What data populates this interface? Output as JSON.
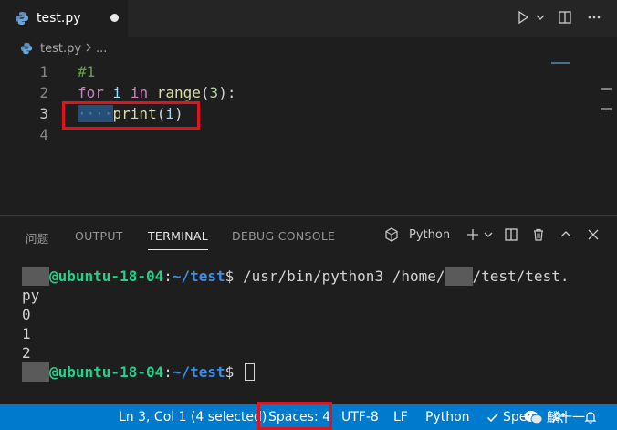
{
  "tab": {
    "filename": "test.py"
  },
  "breadcrumb": {
    "filename": "test.py",
    "more": "..."
  },
  "editor": {
    "line_numbers": [
      "1",
      "2",
      "3",
      "4"
    ],
    "line1": {
      "comment": "#1"
    },
    "line2": {
      "kw_for": "for",
      "var": "i",
      "kw_in": "in",
      "fn": "range",
      "open": "(",
      "num": "3",
      "close": "):"
    },
    "line3": {
      "whitespace_dots": "····",
      "fn": "print",
      "open": "(",
      "var": "i",
      "close": ")"
    }
  },
  "panel": {
    "tabs": [
      "问题",
      "OUTPUT",
      "TERMINAL",
      "DEBUG CONSOLE"
    ],
    "active_tab": "TERMINAL",
    "shell_label": "Python"
  },
  "terminal": {
    "prompt_user": "@ubuntu-18-04",
    "prompt_sep": ":",
    "prompt_path": "~/test",
    "prompt_symbol": "$",
    "command_part1": " /usr/bin/python3 /home/",
    "command_part2": "/test/test.",
    "command_wrap": "py",
    "outputs": [
      "0",
      "1",
      "2"
    ]
  },
  "statusbar": {
    "position": "Ln 3, Col 1 (4 selected)",
    "spaces": "Spaces: 4",
    "encoding": "UTF-8",
    "eol": "LF",
    "language": "Python",
    "spell": "Spell",
    "watermark": "麟十一"
  },
  "colors": {
    "statusbar_bg": "#007acc",
    "highlight_box": "#e0141e",
    "selection": "#264f78"
  }
}
